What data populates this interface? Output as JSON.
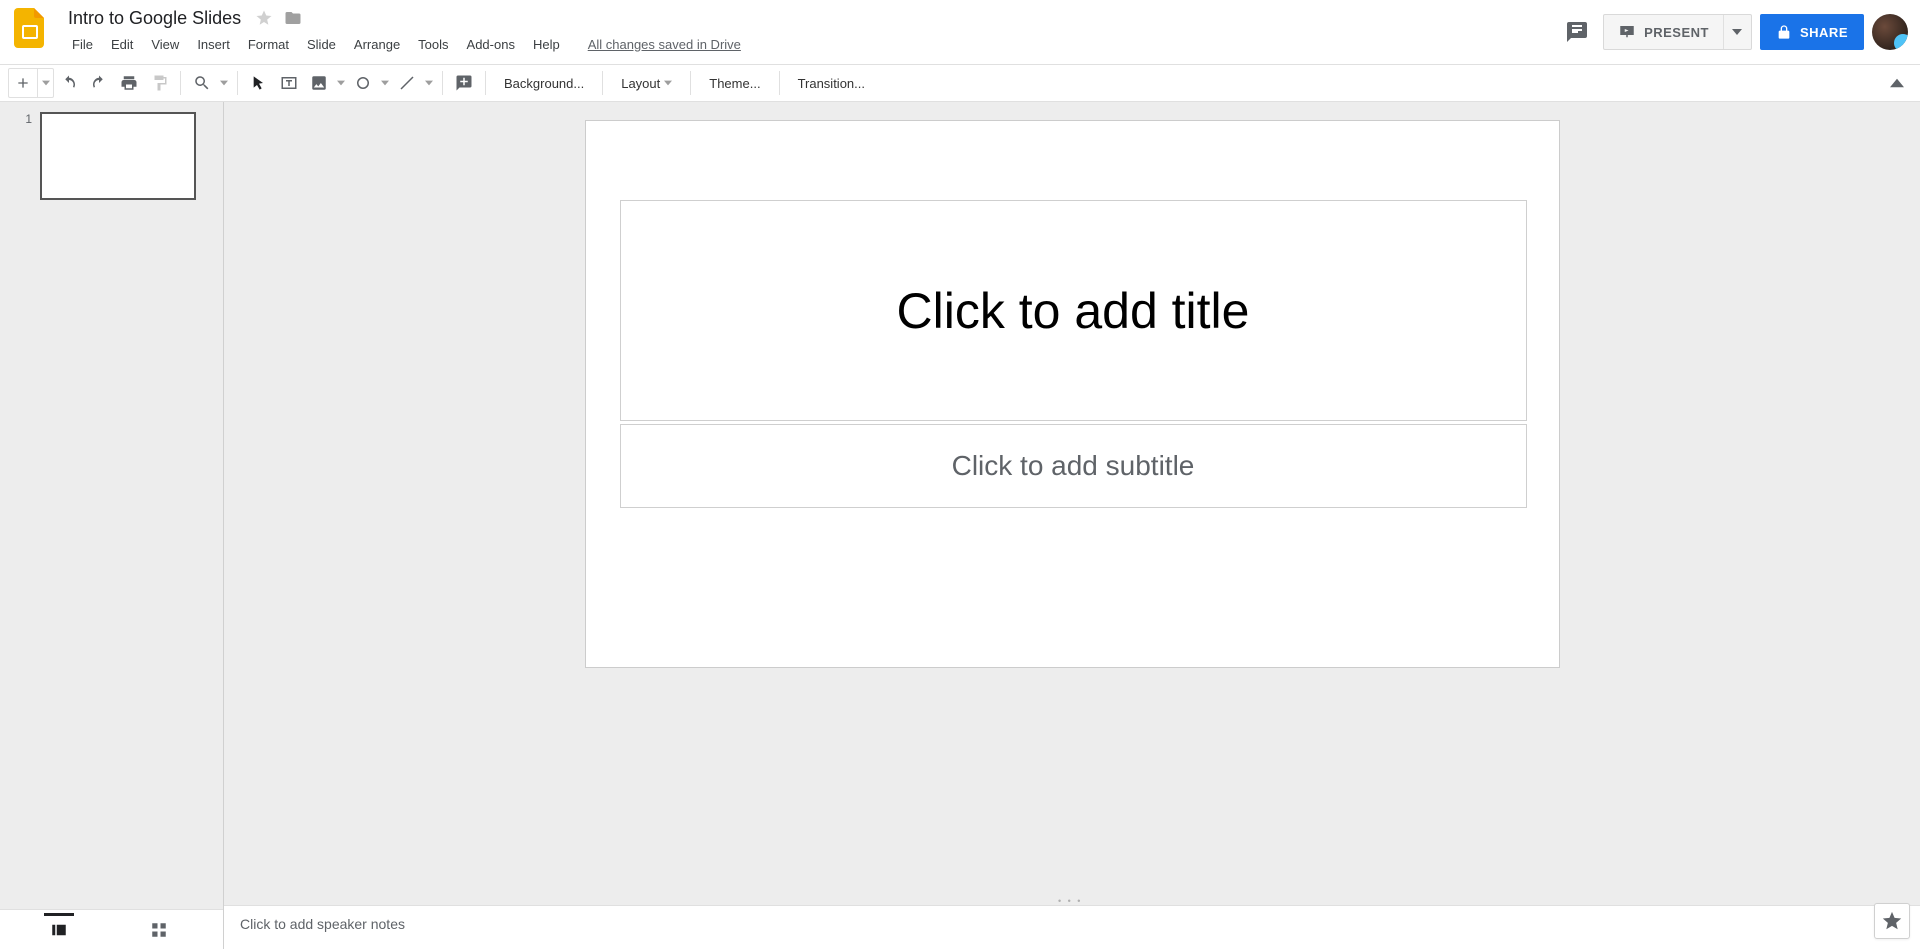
{
  "doc": {
    "title": "Intro to Google Slides",
    "status": "All changes saved in Drive"
  },
  "menus": [
    "File",
    "Edit",
    "View",
    "Insert",
    "Format",
    "Slide",
    "Arrange",
    "Tools",
    "Add-ons",
    "Help"
  ],
  "header_buttons": {
    "present": "PRESENT",
    "share": "SHARE"
  },
  "toolbar_text": {
    "background": "Background...",
    "layout": "Layout",
    "theme": "Theme...",
    "transition": "Transition..."
  },
  "filmstrip": {
    "slides": [
      {
        "number": "1"
      }
    ]
  },
  "canvas": {
    "title_placeholder": "Click to add title",
    "subtitle_placeholder": "Click to add subtitle"
  },
  "notes": {
    "placeholder": "Click to add speaker notes"
  }
}
